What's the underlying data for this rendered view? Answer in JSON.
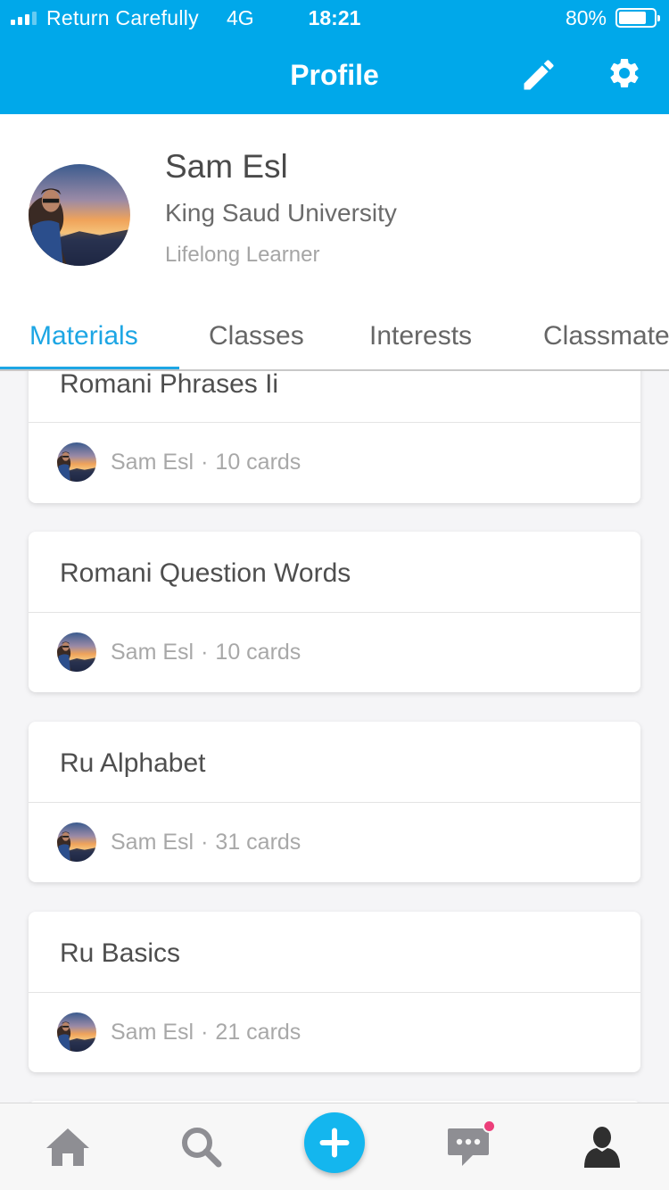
{
  "status_bar": {
    "carrier": "Return Carefully",
    "network": "4G",
    "time": "18:21",
    "battery": "80%",
    "battery_level": 0.8
  },
  "header": {
    "title": "Profile",
    "icons": [
      "edit-icon",
      "gear-icon"
    ]
  },
  "profile": {
    "name": "Sam Esl",
    "school": "King Saud University",
    "role": "Lifelong Learner"
  },
  "tabs": [
    {
      "label": "Materials",
      "active": true
    },
    {
      "label": "Classes"
    },
    {
      "label": "Interests"
    },
    {
      "label": "Classmates"
    }
  ],
  "materials": [
    {
      "title": "Romani Phrases Ii",
      "author": "Sam Esl",
      "separator": "·",
      "cards": "10 cards"
    },
    {
      "title": "Romani Question Words",
      "author": "Sam Esl",
      "separator": "·",
      "cards": "10 cards"
    },
    {
      "title": "Ru Alphabet",
      "author": "Sam Esl",
      "separator": "·",
      "cards": "31 cards"
    },
    {
      "title": "Ru Basics",
      "author": "Sam Esl",
      "separator": "·",
      "cards": "21 cards"
    }
  ],
  "tabbar": {
    "icons": [
      "home-icon",
      "search-icon",
      "plus-icon",
      "chat-icon",
      "person-icon"
    ],
    "chat_badge_color": "#ec3f7a"
  },
  "colors": {
    "accent": "#00a8ea",
    "active_tab": "#1da6e4"
  }
}
